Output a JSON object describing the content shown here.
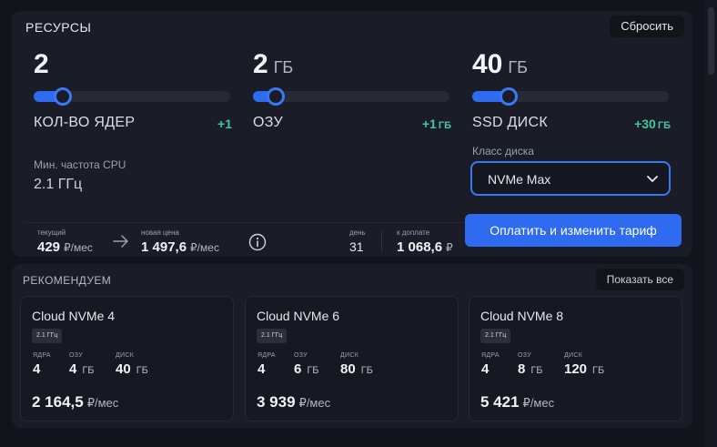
{
  "resources": {
    "title": "РЕСУРСЫ",
    "reset_label": "Сбросить",
    "cores": {
      "value": "2",
      "unit": "",
      "label": "КОЛ-ВО ЯДЕР",
      "delta": "+1",
      "delta_unit": "",
      "slider_fraction": 0.1
    },
    "ram": {
      "value": "2",
      "unit": "ГБ",
      "label": "ОЗУ",
      "delta": "+1",
      "delta_unit": "ГБ",
      "slider_fraction": 0.07
    },
    "ssd": {
      "value": "40",
      "unit": "ГБ",
      "label": "SSD ДИСК",
      "delta": "+30",
      "delta_unit": "ГБ",
      "slider_fraction": 0.14
    },
    "cpu_freq_label": "Мин. частота CPU",
    "cpu_freq_value": "2.1 ГГц",
    "disk_class_label": "Класс диска",
    "disk_class_value": "NVMe Max"
  },
  "summary": {
    "current_label": "текущий",
    "current_value": "429",
    "current_unit": "₽/мес",
    "new_label": "новая цена",
    "new_value": "1 497,6",
    "new_unit": "₽/мес",
    "days_label": "день",
    "days_value": "31",
    "topay_label": "к доплате",
    "topay_value": "1 068,6",
    "topay_unit": "₽",
    "pay_button": "Оплатить и изменить тариф"
  },
  "recommend": {
    "title": "РЕКОМЕНДУЕМ",
    "show_all": "Показать все",
    "cards": [
      {
        "name": "Cloud NVMe 4",
        "badge": "2.1 ГГц",
        "cores_label": "ЯДРА",
        "cores": "4",
        "ram_label": "ОЗУ",
        "ram": "4",
        "ram_unit": "ГБ",
        "disk_label": "ДИСК",
        "disk": "40",
        "disk_unit": "ГБ",
        "price": "2 164,5",
        "price_unit": "₽/мес"
      },
      {
        "name": "Cloud NVMe 6",
        "badge": "2.1 ГГц",
        "cores_label": "ЯДРА",
        "cores": "4",
        "ram_label": "ОЗУ",
        "ram": "6",
        "ram_unit": "ГБ",
        "disk_label": "ДИСК",
        "disk": "80",
        "disk_unit": "ГБ",
        "price": "3 939",
        "price_unit": "₽/мес"
      },
      {
        "name": "Cloud NVMe 8",
        "badge": "2.1 ГГц",
        "cores_label": "ЯДРА",
        "cores": "4",
        "ram_label": "ОЗУ",
        "ram": "8",
        "ram_unit": "ГБ",
        "disk_label": "ДИСК",
        "disk": "120",
        "disk_unit": "ГБ",
        "price": "5 421",
        "price_unit": "₽/мес"
      }
    ]
  },
  "colors": {
    "accent": "#2e6bf0",
    "positive": "#3fc99a",
    "panel": "#1a1d27",
    "background": "#12141c"
  },
  "icons": {
    "arrow": "arrow-right-icon",
    "info": "info-icon",
    "chevron": "chevron-down-icon"
  }
}
